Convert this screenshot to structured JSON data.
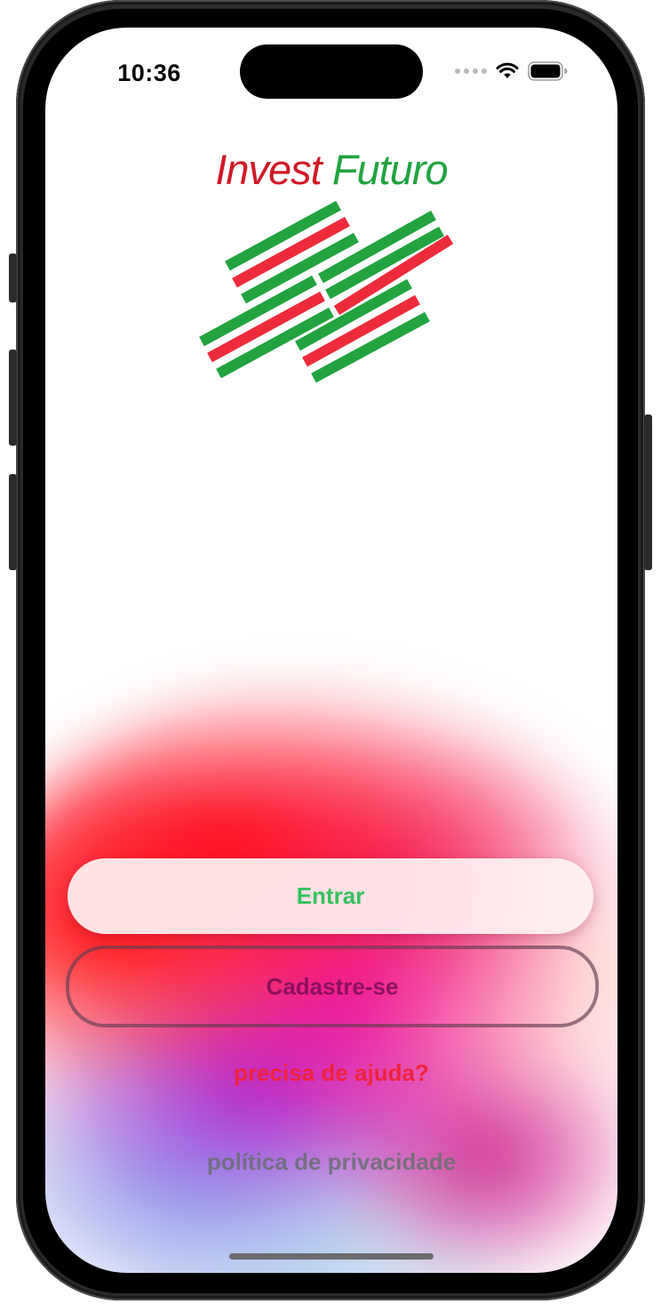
{
  "status_bar": {
    "time": "10:36"
  },
  "brand": {
    "word1": "Invest",
    "word2": "Futuro",
    "colors": {
      "red": "#cf1a26",
      "green": "#21a33f"
    }
  },
  "logo": {
    "name": "invest-futuro-logo"
  },
  "actions": {
    "login_label": "Entrar",
    "signup_label": "Cadastre-se",
    "help_label": "precisa de ajuda?",
    "privacy_label": "política de privacidade"
  },
  "colors": {
    "login_text": "#35c15b",
    "help_text": "#f0223c"
  },
  "icons": {
    "cellular": "cellular-signal-icon",
    "wifi": "wifi-icon",
    "battery": "battery-icon"
  }
}
